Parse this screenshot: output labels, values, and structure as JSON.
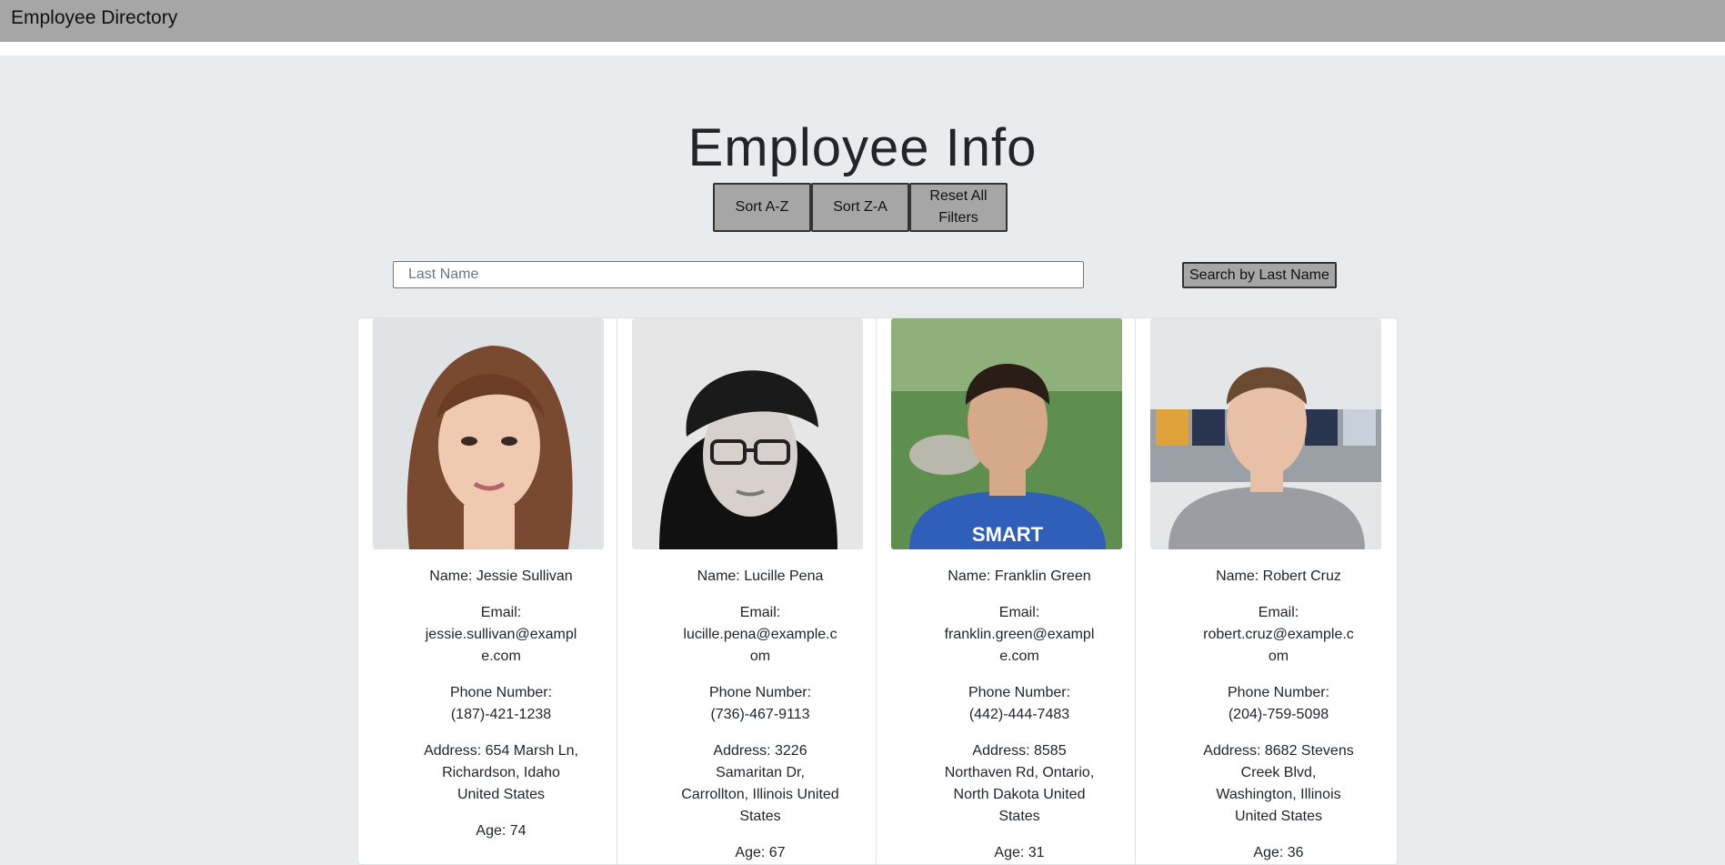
{
  "navbar": {
    "brand": "Employee Directory"
  },
  "header": {
    "title": "Employee Info"
  },
  "buttons": {
    "sort_az": "Sort A-Z",
    "sort_za": "Sort Z-A",
    "reset": "Reset All Filters"
  },
  "search": {
    "placeholder": "Last Name",
    "value": "",
    "button_label": "Search by Last Name"
  },
  "employees": [
    {
      "name": "Name: Jessie Sullivan",
      "email_label": "Email:",
      "email": "jessie.sullivan@example.com",
      "phone_label": "Phone Number:",
      "phone": "(187)-421-1238",
      "address": "Address: 654 Marsh Ln, Richardson, Idaho United States",
      "age": "Age: 74"
    },
    {
      "name": "Name: Lucille Pena",
      "email_label": "Email:",
      "email": "lucille.pena@example.com",
      "phone_label": "Phone Number:",
      "phone": "(736)-467-9113",
      "address": "Address: 3226 Samaritan Dr, Carrollton, Illinois United States",
      "age": "Age: 67"
    },
    {
      "name": "Name: Franklin Green",
      "email_label": "Email:",
      "email": "franklin.green@example.com",
      "phone_label": "Phone Number:",
      "phone": "(442)-444-7483",
      "address": "Address: 8585 Northaven Rd, Ontario, North Dakota United States",
      "age": "Age: 31"
    },
    {
      "name": "Name: Robert Cruz",
      "email_label": "Email:",
      "email": "robert.cruz@example.com",
      "phone_label": "Phone Number:",
      "phone": "(204)-759-5098",
      "address": "Address: 8682 Stevens Creek Blvd, Washington, Illinois United States",
      "age": "Age: 36"
    }
  ]
}
